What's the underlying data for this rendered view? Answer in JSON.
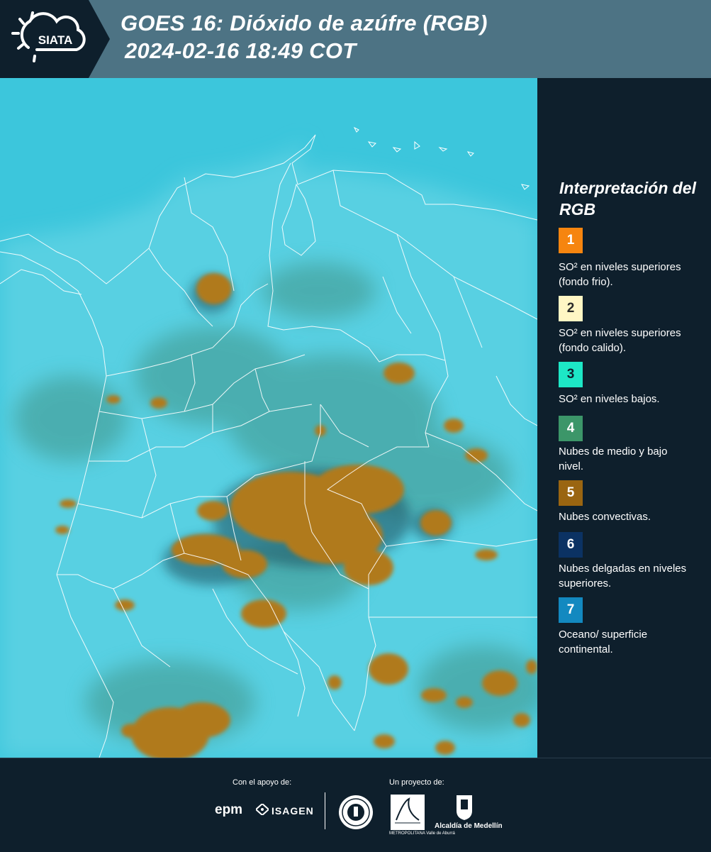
{
  "header": {
    "logo_text": "SIATA",
    "title_line1": "GOES 16: Dióxido de azúfre (RGB)",
    "title_line2": "2024-02-16 18:49 COT"
  },
  "map": {
    "ocean_color": "#3cc6dc",
    "land_color": "#5fd3e4",
    "convective_cloud_color": "#b07a1e",
    "mid_low_cloud_color": "#3f8c7d",
    "border_color": "#ffffff"
  },
  "legend": {
    "title": "Interpretación del RGB",
    "items": [
      {
        "number": "1",
        "color": "#f6850f",
        "text_color": "#ffffff",
        "label": "SO² en niveles superiores (fondo frio)."
      },
      {
        "number": "2",
        "color": "#fff6c4",
        "text_color": "#2a2a2a",
        "label": "SO² en niveles superiores (fondo calido)."
      },
      {
        "number": "3",
        "color": "#1de7c6",
        "text_color": "#0e1f2c",
        "label": "SO² en niveles bajos."
      },
      {
        "number": "4",
        "color": "#3c9669",
        "text_color": "#ffffff",
        "label": "Nubes de medio y bajo nivel."
      },
      {
        "number": "5",
        "color": "#9a6511",
        "text_color": "#ffffff",
        "label": "Nubes convectivas."
      },
      {
        "number": "6",
        "color": "#0b3263",
        "text_color": "#ffffff",
        "label": "Nubes delgadas en niveles superiores."
      },
      {
        "number": "7",
        "color": "#1389c0",
        "text_color": "#ffffff",
        "label": "Oceano/ superficie continental."
      }
    ]
  },
  "footer": {
    "support_caption": "Con el apoyo de:",
    "project_caption": "Un proyecto de:",
    "epm_logo": "epm",
    "isagen_logo": "ISAGEN",
    "area_logo_label": "METROPOLITANA Valle de Aburrá",
    "alcaldia_label": "Alcaldía de Medellín"
  }
}
